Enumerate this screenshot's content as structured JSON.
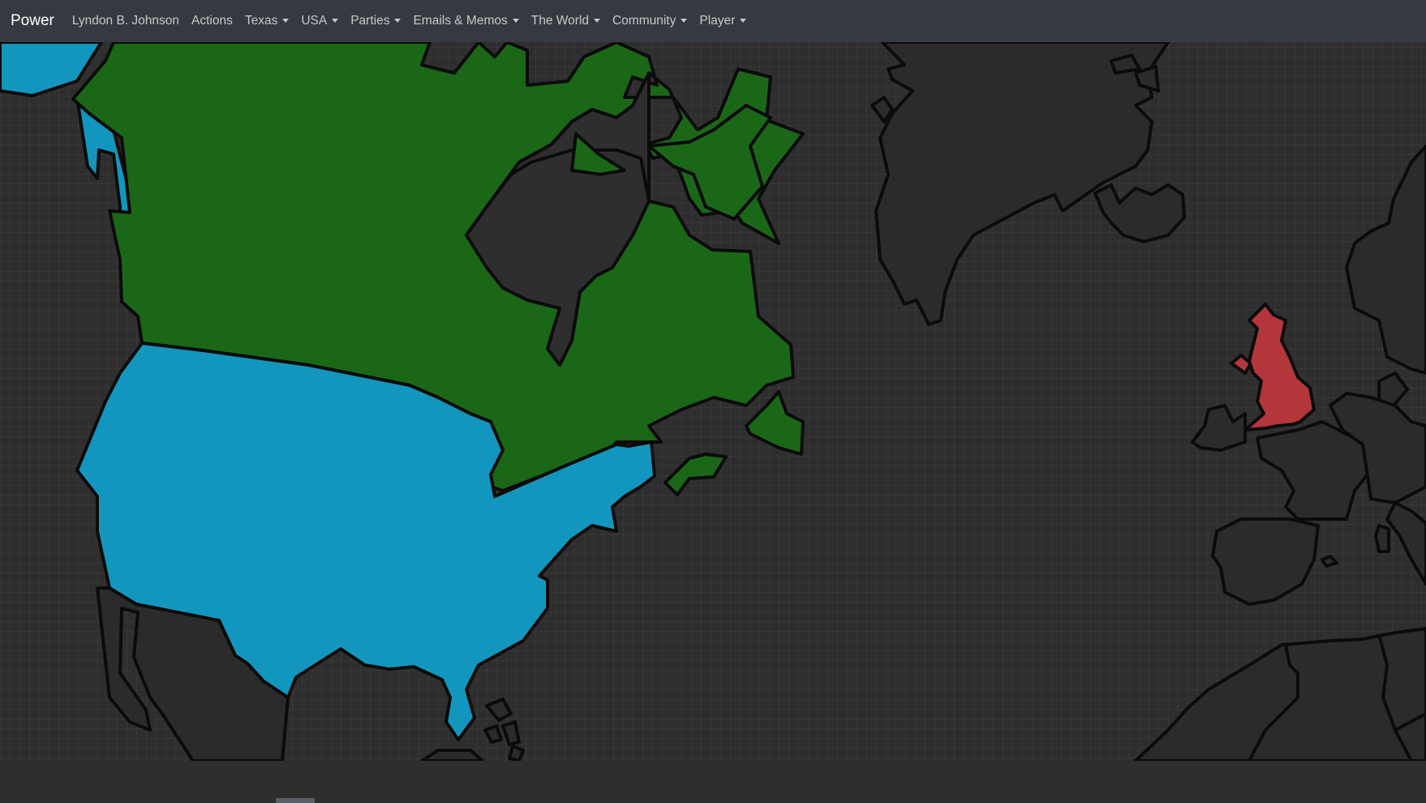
{
  "navbar": {
    "brand": "Power",
    "items": [
      {
        "label": "Lyndon B. Johnson",
        "dropdown": false
      },
      {
        "label": "Actions",
        "dropdown": false
      },
      {
        "label": "Texas",
        "dropdown": true
      },
      {
        "label": "USA",
        "dropdown": true
      },
      {
        "label": "Parties",
        "dropdown": true
      },
      {
        "label": "Emails & Memos",
        "dropdown": true
      },
      {
        "label": "The World",
        "dropdown": true
      },
      {
        "label": "Community",
        "dropdown": true
      },
      {
        "label": "Player",
        "dropdown": true
      }
    ]
  },
  "map": {
    "colors": {
      "usa": "#1396bd",
      "canada": "#1b6718",
      "united_kingdom": "#b3363a",
      "neutral_land": "#2b2b2c",
      "ocean": "#2e2e2f",
      "outline": "#0b0b0b"
    }
  }
}
